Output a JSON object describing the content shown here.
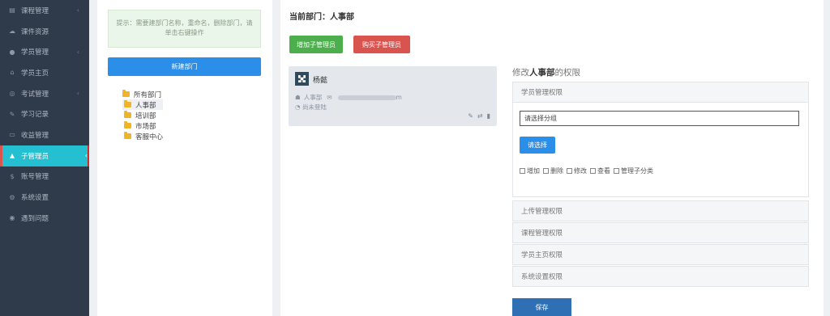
{
  "sidebar": {
    "items": [
      {
        "label": "课程管理",
        "icon": "book-icon",
        "chev": "‹"
      },
      {
        "label": "课件资源",
        "icon": "cloud-icon",
        "chev": ""
      },
      {
        "label": "学员管理",
        "icon": "users-icon",
        "chev": "‹"
      },
      {
        "label": "学员主页",
        "icon": "home-icon",
        "chev": ""
      },
      {
        "label": "考试管理",
        "icon": "exam-icon",
        "chev": "‹"
      },
      {
        "label": "学习记录",
        "icon": "record-icon",
        "chev": ""
      },
      {
        "label": "收益管理",
        "icon": "wallet-icon",
        "chev": ""
      },
      {
        "label": "子管理员",
        "icon": "user-icon",
        "chev": "‹"
      },
      {
        "label": "账号管理",
        "icon": "dollar-icon",
        "chev": ""
      },
      {
        "label": "系统设置",
        "icon": "gear-icon",
        "chev": ""
      },
      {
        "label": "遇到问题",
        "icon": "help-icon",
        "chev": ""
      }
    ],
    "active_index": 7
  },
  "left_panel": {
    "tip": "提示：需要建部门名称，重命名，删除部门，请单击右键操作",
    "new_dept_button": "新建部门",
    "tree": [
      {
        "label": "所有部门",
        "level": 0,
        "selected": false
      },
      {
        "label": "人事部",
        "level": 1,
        "selected": true
      },
      {
        "label": "培训部",
        "level": 1,
        "selected": false
      },
      {
        "label": "市场部",
        "level": 1,
        "selected": false
      },
      {
        "label": "客服中心",
        "level": 1,
        "selected": false
      }
    ]
  },
  "main": {
    "current_dept_label": "当前部门：人事部",
    "add_sub_admin_button": "增加子管理员",
    "buy_sub_admin_button": "购买子管理员",
    "user_card": {
      "name": "杨懿",
      "dept": "人事部",
      "email_suffix": "m",
      "status": "尚未登陆"
    },
    "permission_title_prefix": "修改",
    "permission_title_dept": "人事部",
    "permission_title_suffix": "的权限",
    "sections": [
      {
        "label": "学员管理权限",
        "expanded": true
      },
      {
        "label": "上传管理权限",
        "expanded": false
      },
      {
        "label": "课程管理权限",
        "expanded": false
      },
      {
        "label": "学员主页权限",
        "expanded": false
      },
      {
        "label": "系统设置权限",
        "expanded": false
      }
    ],
    "group_select_value": "请选择分组",
    "choose_button": "请选择",
    "checkboxes": [
      "增加",
      "删除",
      "修改",
      "查看",
      "管理子分类"
    ],
    "save_button": "保存"
  },
  "colors": {
    "sidebar_bg": "#2f3a4a",
    "active_item": "#25bfd2",
    "primary": "#2b8ee8",
    "success": "#4cae4c",
    "danger": "#d9534f"
  }
}
